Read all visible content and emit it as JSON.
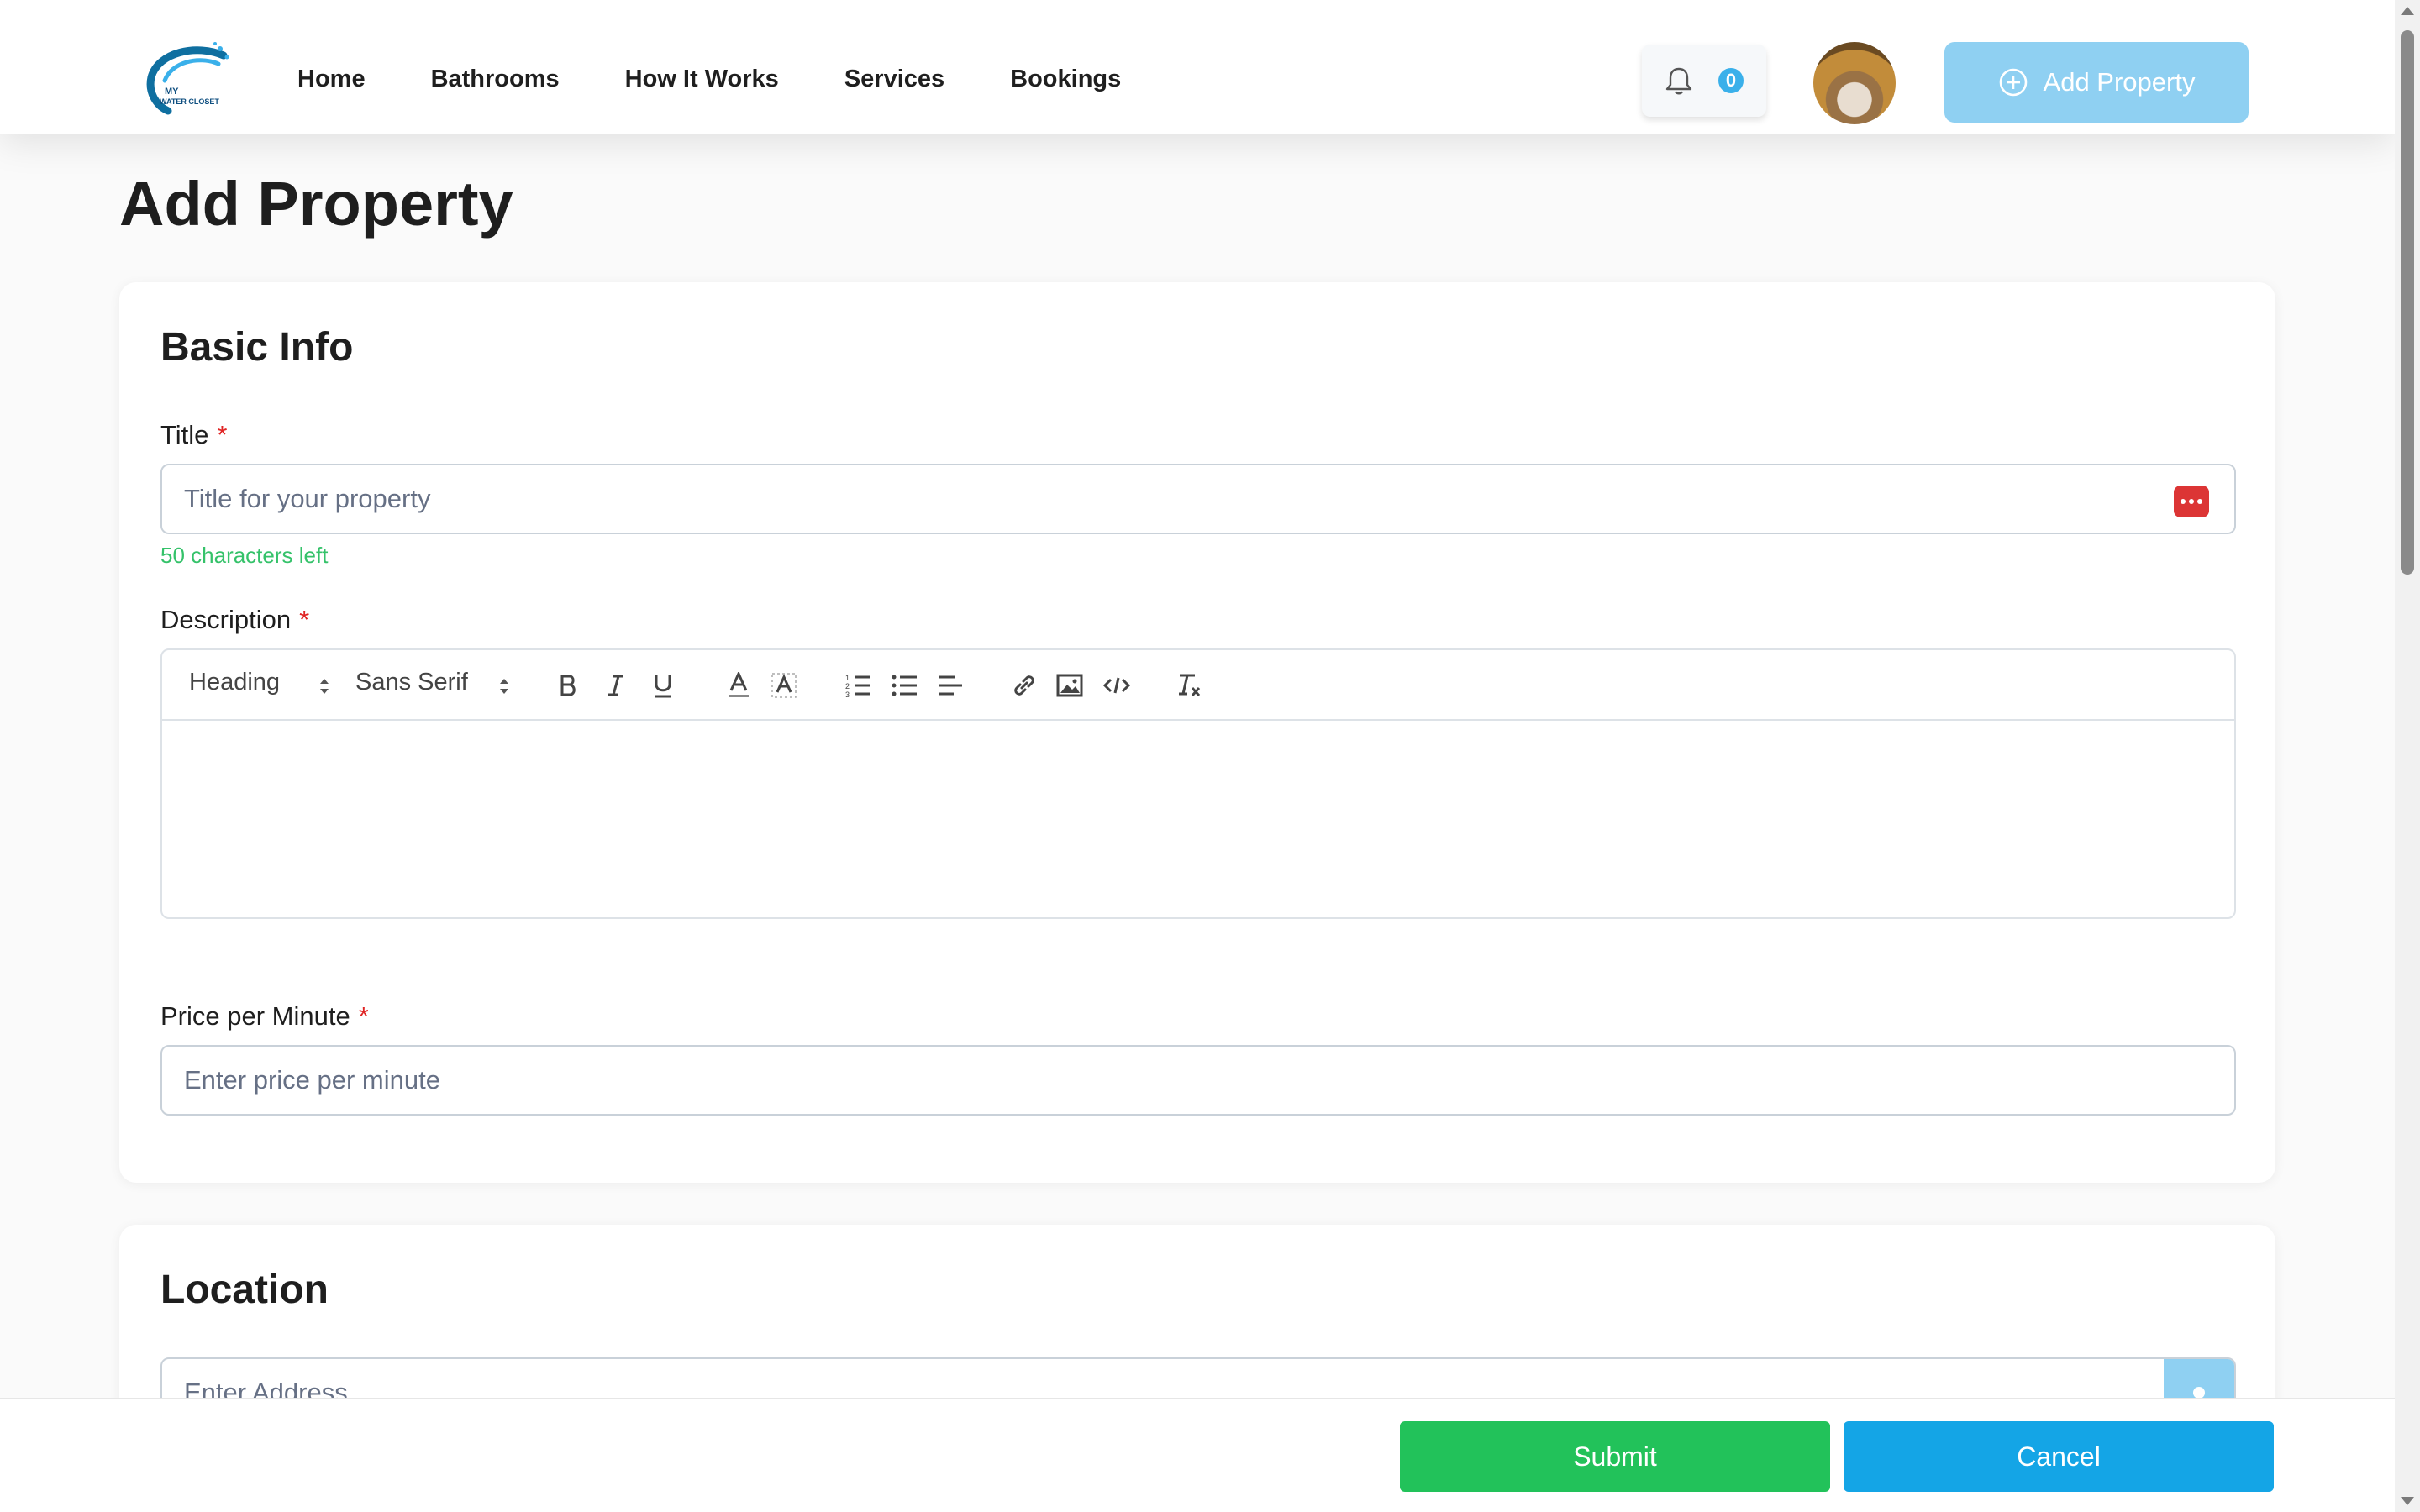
{
  "brand": {
    "logo_text_line1": "MY",
    "logo_text_line2": "WATER CLOSET",
    "accent": "#0f6fa0"
  },
  "nav": {
    "items": [
      {
        "label": "Home"
      },
      {
        "label": "Bathrooms"
      },
      {
        "label": "How It Works"
      },
      {
        "label": "Services"
      },
      {
        "label": "Bookings"
      }
    ],
    "notifications": {
      "icon": "bell-icon",
      "count": "0"
    },
    "avatar_icon": "user-avatar",
    "add_property": {
      "label": "Add Property",
      "icon": "plus-circle-icon",
      "color": "#8fd0f2"
    }
  },
  "page": {
    "title": "Add Property"
  },
  "basic_info": {
    "heading": "Basic Info",
    "title_field": {
      "label": "Title",
      "required_mark": "*",
      "placeholder": "Title for your property",
      "hint": "50 characters left",
      "icon": "password-manager-icon"
    },
    "description_field": {
      "label": "Description",
      "required_mark": "*",
      "heading_select": "Heading",
      "font_select": "Sans Serif",
      "toolbar_icons": [
        "bold-icon",
        "italic-icon",
        "underline-icon",
        "text-color-icon",
        "background-color-icon",
        "ordered-list-icon",
        "bullet-list-icon",
        "align-icon",
        "link-icon",
        "image-icon",
        "code-icon",
        "clear-format-icon"
      ]
    },
    "price_field": {
      "label": "Price per Minute",
      "required_mark": "*",
      "placeholder": "Enter price per minute"
    }
  },
  "location": {
    "heading": "Location",
    "address_placeholder": "Enter Address",
    "locate_icon": "map-pin-icon"
  },
  "footer": {
    "submit_label": "Submit",
    "cancel_label": "Cancel",
    "submit_color": "#22c25a",
    "cancel_color": "#14a5e6"
  }
}
